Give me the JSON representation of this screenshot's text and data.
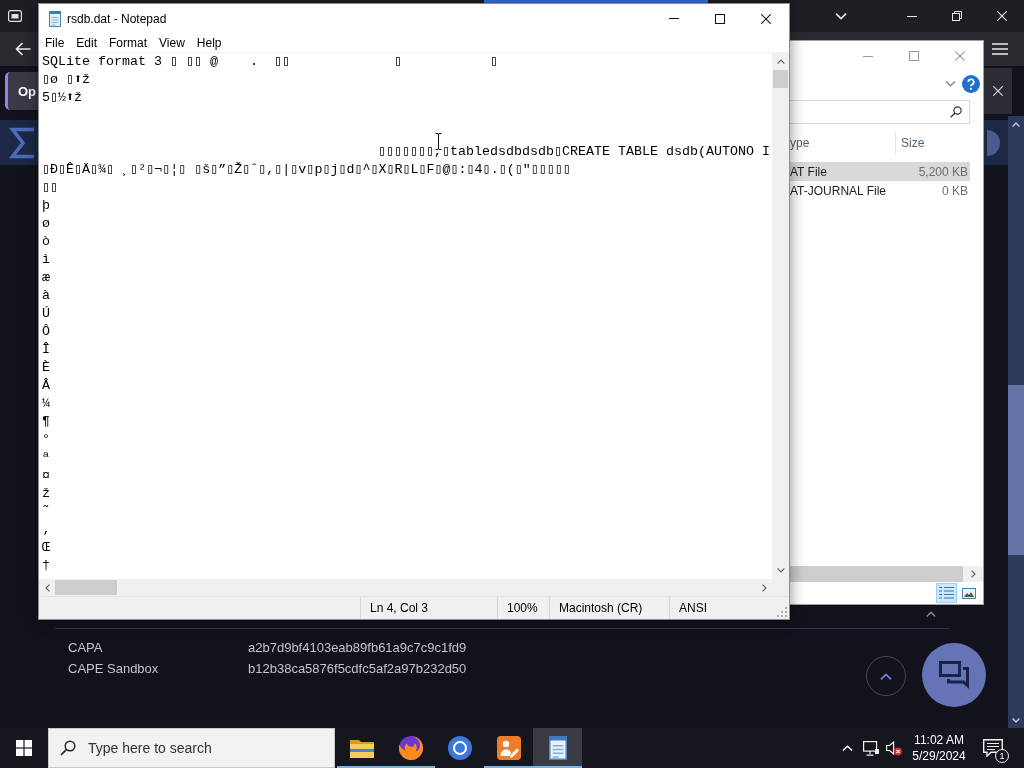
{
  "notepad": {
    "title": "rsdb.dat - Notepad",
    "menu": [
      "File",
      "Edit",
      "Format",
      "View",
      "Help"
    ],
    "content": "SQLite format 3 ▯ ▯▯ @    .  ▯▯             ▯           ▯\n▯ø ▯⬆ž\n5▯½⬆ž\n\n\n                                          ▯▯▯▯▯▯▯,▯tabledsdbdsdb▯CREATE TABLE dsdb(AUTONO I\n▯Ð▯Ê▯Ä▯¾▯ ¸▯²▯¬▯¦▯ ▯š▯”▯Ž▯ˆ▯,▯|▯v▯p▯j▯d▯^▯X▯R▯L▯F▯@▯:▯4▯.▯(▯\"▯▯▯▯▯\n▯▯\nþ\nø\nò\nì\næ\nà\nÚ\nÔ\nÎ\nÈ\nÂ\n¼\n¶\n°\nª\n¤\nž\n˜\n‚\nŒ\n†",
    "status": {
      "position": "Ln 4, Col 3",
      "zoom": "100%",
      "line_endings": "Macintosh (CR)",
      "encoding": "ANSI"
    }
  },
  "explorer": {
    "columns": [
      "ype",
      "Size"
    ],
    "rows": [
      {
        "column_1": "AT File",
        "size": "5,200 KB",
        "selected": true
      },
      {
        "column_1": "AT-JOURNAL File",
        "size": "0 KB",
        "selected": false
      }
    ],
    "views": [
      {
        "kind": "details",
        "selected": true
      },
      {
        "kind": "thumbnails",
        "selected": false
      }
    ]
  },
  "browser_page": {
    "button_label": "Op",
    "hashes": [
      {
        "name": "CAPA",
        "value": "a2b7d9bf4103eab89fb61a9c7c9c1fd9"
      },
      {
        "name": "CAPE Sandbox",
        "value": "b12b38ca5876f5cdfc5af2a97b232d50"
      }
    ]
  },
  "taskbar": {
    "search": {
      "placeholder": "Type here to search"
    },
    "apps": [
      {
        "kind": "folder",
        "running": true,
        "selected": false
      },
      {
        "kind": "globe",
        "running": true,
        "selected": false
      },
      {
        "kind": "ring",
        "running": false,
        "selected": false
      },
      {
        "kind": "tile",
        "running": true,
        "selected": false
      },
      {
        "kind": "notepad",
        "running": true,
        "selected": true
      }
    ],
    "clock": {
      "time": "11:02 AM",
      "date": "5/29/2024"
    },
    "notification_count": "1"
  }
}
